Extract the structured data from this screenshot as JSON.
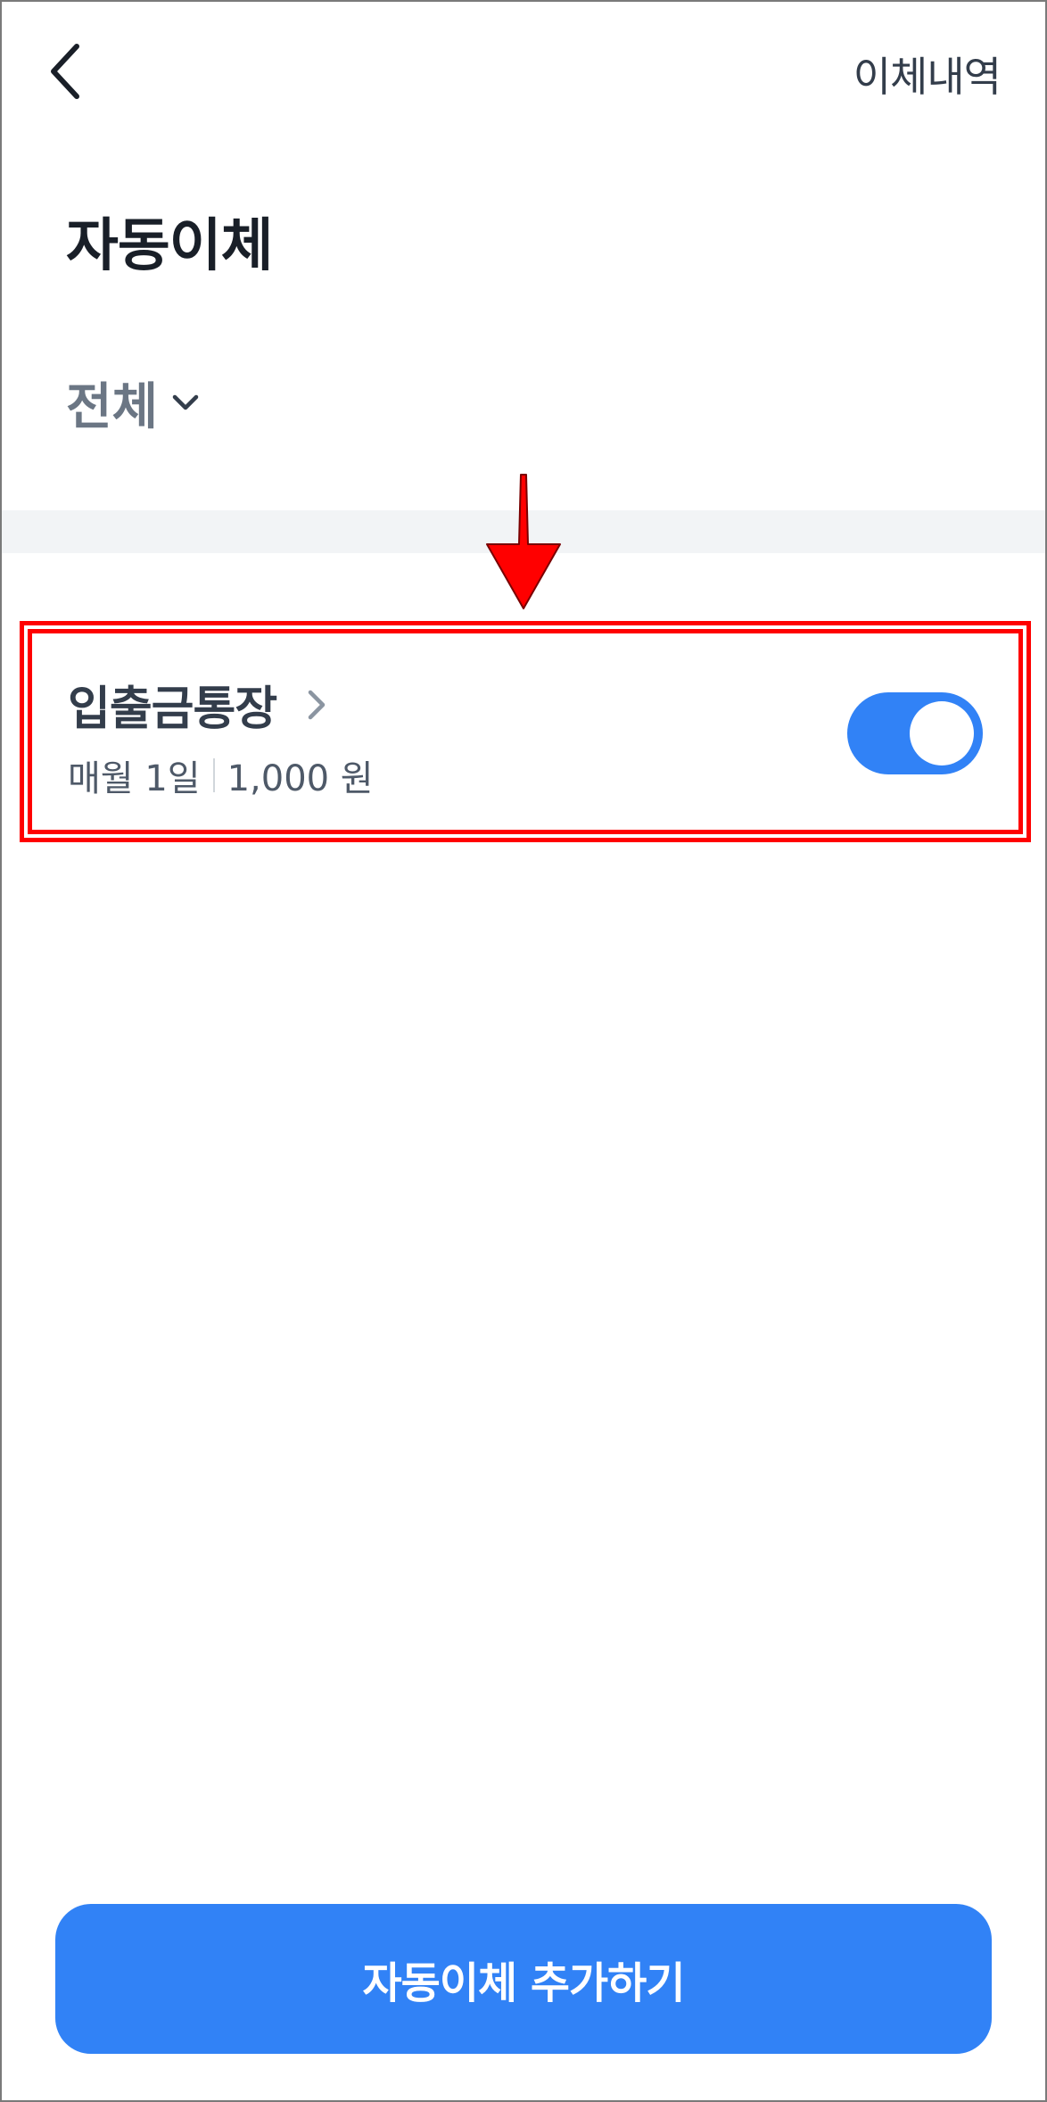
{
  "header": {
    "back_icon": "chevron-left-icon",
    "history_link": "이체내역"
  },
  "page": {
    "title": "자동이체"
  },
  "filter": {
    "selected": "전체",
    "icon": "chevron-down-icon"
  },
  "annotation": {
    "arrow_color": "#ff0000",
    "highlight_color": "#ff0000"
  },
  "transfers": [
    {
      "name": "입출금통장",
      "schedule": "매월 1일",
      "amount": "1,000 원",
      "enabled": true
    }
  ],
  "cta": {
    "label": "자동이체 추가하기"
  },
  "colors": {
    "accent": "#3182f6",
    "divider": "#f2f4f6",
    "title": "#191f28",
    "muted": "#6b7684"
  }
}
